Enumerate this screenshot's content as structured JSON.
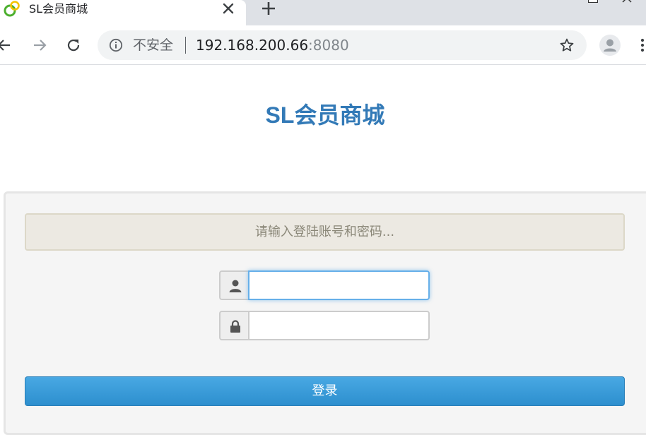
{
  "browser": {
    "tab_title": "SL会员商城",
    "security_label": "不安全",
    "url_host": "192.168.200.66",
    "url_port": ":8080"
  },
  "page": {
    "title": "SL会员商城",
    "alert_text": "请输入登陆账号和密码...",
    "username_value": "",
    "password_value": "",
    "login_button": "登录"
  },
  "colors": {
    "title": "#337ab7",
    "button": "#3b9cdb",
    "alert_bg": "#ece9e2",
    "focus": "#66afe9"
  }
}
